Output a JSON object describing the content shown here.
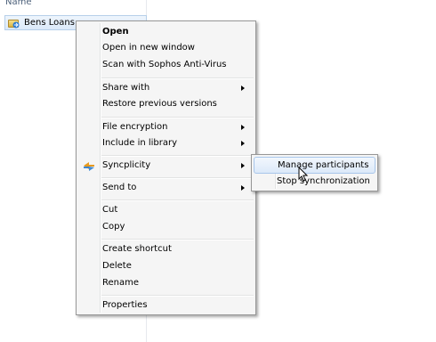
{
  "column_header": "Name",
  "file": {
    "name": "Bens Loans",
    "icon": "syncplicity-folder-icon"
  },
  "context_menu": {
    "items": [
      {
        "label": "Open",
        "bold": true
      },
      {
        "label": "Open in new window"
      },
      {
        "label": "Scan with Sophos Anti-Virus"
      },
      {
        "label": "Share with",
        "submenu": true
      },
      {
        "label": "Restore previous versions"
      },
      {
        "label": "File encryption",
        "submenu": true
      },
      {
        "label": "Include in library",
        "submenu": true
      },
      {
        "label": "Syncplicity",
        "submenu": true,
        "icon": "syncplicity-icon"
      },
      {
        "label": "Send to",
        "submenu": true
      },
      {
        "label": "Cut"
      },
      {
        "label": "Copy"
      },
      {
        "label": "Create shortcut"
      },
      {
        "label": "Delete"
      },
      {
        "label": "Rename"
      },
      {
        "label": "Properties"
      }
    ]
  },
  "submenu": {
    "items": [
      {
        "label": "Manage participants",
        "highlighted": true
      },
      {
        "label": "Stop synchronization"
      }
    ]
  },
  "colors": {
    "highlight_border": "#a8c6ea",
    "menu_bg": "#f5f5f5"
  }
}
